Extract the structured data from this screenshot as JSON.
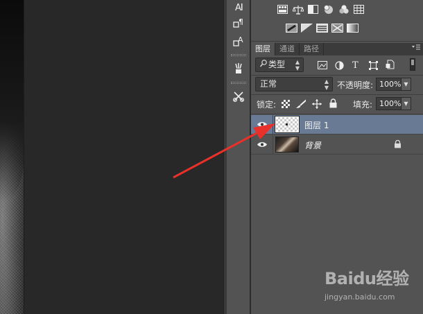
{
  "panel_tabs": [
    "图层",
    "通道",
    "路径"
  ],
  "filter": {
    "label": "类型"
  },
  "blend": {
    "mode": "正常",
    "opacity_label": "不透明度:",
    "opacity_value": "100%"
  },
  "lock": {
    "label": "锁定:",
    "fill_label": "填充:",
    "fill_value": "100%"
  },
  "layers": [
    {
      "name": "图层 1",
      "selected": true,
      "visible": true,
      "locked": false
    },
    {
      "name": "背景",
      "selected": false,
      "visible": true,
      "locked": true
    }
  ],
  "tool_icons": [
    "character-icon",
    "paragraph-style-icon",
    "character-style-icon",
    "brush-presets-icon",
    "tool-presets-icon"
  ],
  "adjustment_icons_row1": [
    "brightness-contrast-icon",
    "levels-icon",
    "curves-icon",
    "exposure-icon",
    "vibrance-icon",
    "hue-saturation-icon",
    "color-balance-icon"
  ],
  "adjustment_icons_row2": [
    "invert-icon",
    "posterize-icon",
    "threshold-icon",
    "selective-color-icon",
    "gradient-map-icon"
  ],
  "annotation": {
    "arrow_color": "#e8312a"
  },
  "watermark": {
    "logo": "Baidu经验",
    "url": "jingyan.baidu.com"
  },
  "colors": {
    "selected_layer": "#687a94",
    "panel_bg": "#535353",
    "canvas_bg": "#282828"
  }
}
